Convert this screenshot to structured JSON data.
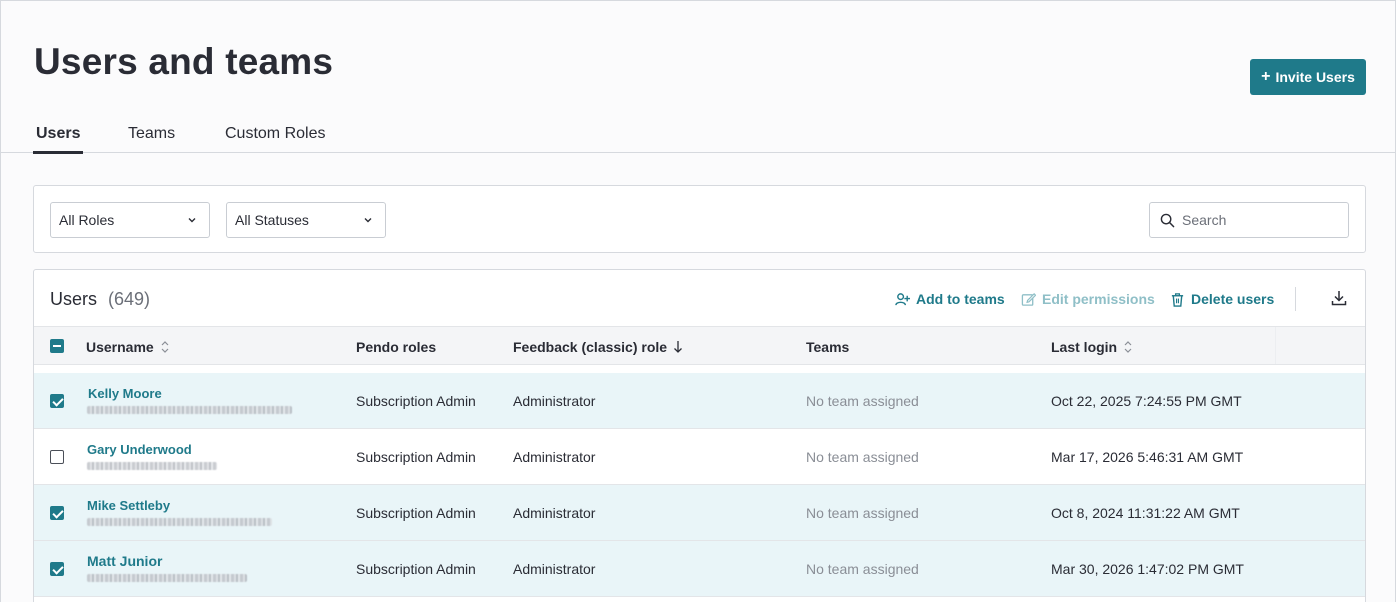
{
  "page": {
    "title": "Users and teams"
  },
  "header": {
    "invite_label": "Invite Users"
  },
  "tabs": [
    {
      "label": "Users",
      "active": true
    },
    {
      "label": "Teams",
      "active": false
    },
    {
      "label": "Custom Roles",
      "active": false
    }
  ],
  "filters": {
    "roles": "All Roles",
    "statuses": "All Statuses",
    "search_placeholder": "Search"
  },
  "table": {
    "title": "Users",
    "count": "(649)",
    "actions": {
      "add_to_teams": "Add to teams",
      "edit_permissions": "Edit permissions",
      "delete_users": "Delete users"
    },
    "columns": {
      "username": "Username",
      "pendo_roles": "Pendo roles",
      "feedback_role": "Feedback (classic) role",
      "teams": "Teams",
      "last_login": "Last login"
    },
    "rows": [
      {
        "name": "Kelly Moore",
        "selected": true,
        "pendo_role": "Subscription Admin",
        "feedback_role": "Administrator",
        "teams": "No team assigned",
        "last_login": "Oct 22, 2025 7:24:55 PM GMT"
      },
      {
        "name": "Gary Underwood",
        "selected": false,
        "pendo_role": "Subscription Admin",
        "feedback_role": "Administrator",
        "teams": "No team assigned",
        "last_login": "Mar 17, 2026 5:46:31 AM GMT"
      },
      {
        "name": "Mike Settleby",
        "selected": true,
        "pendo_role": "Subscription Admin",
        "feedback_role": "Administrator",
        "teams": "No team assigned",
        "last_login": "Oct 8, 2024 11:31:22 AM GMT"
      },
      {
        "name": "Matt Junior",
        "selected": true,
        "pendo_role": "Subscription Admin",
        "feedback_role": "Administrator",
        "teams": "No team assigned",
        "last_login": "Mar 30, 2026 1:47:02 PM GMT"
      }
    ]
  },
  "colors": {
    "accent": "#1f7a8a",
    "selected_row": "#e9f5f8",
    "muted_text": "#8a8e96"
  }
}
